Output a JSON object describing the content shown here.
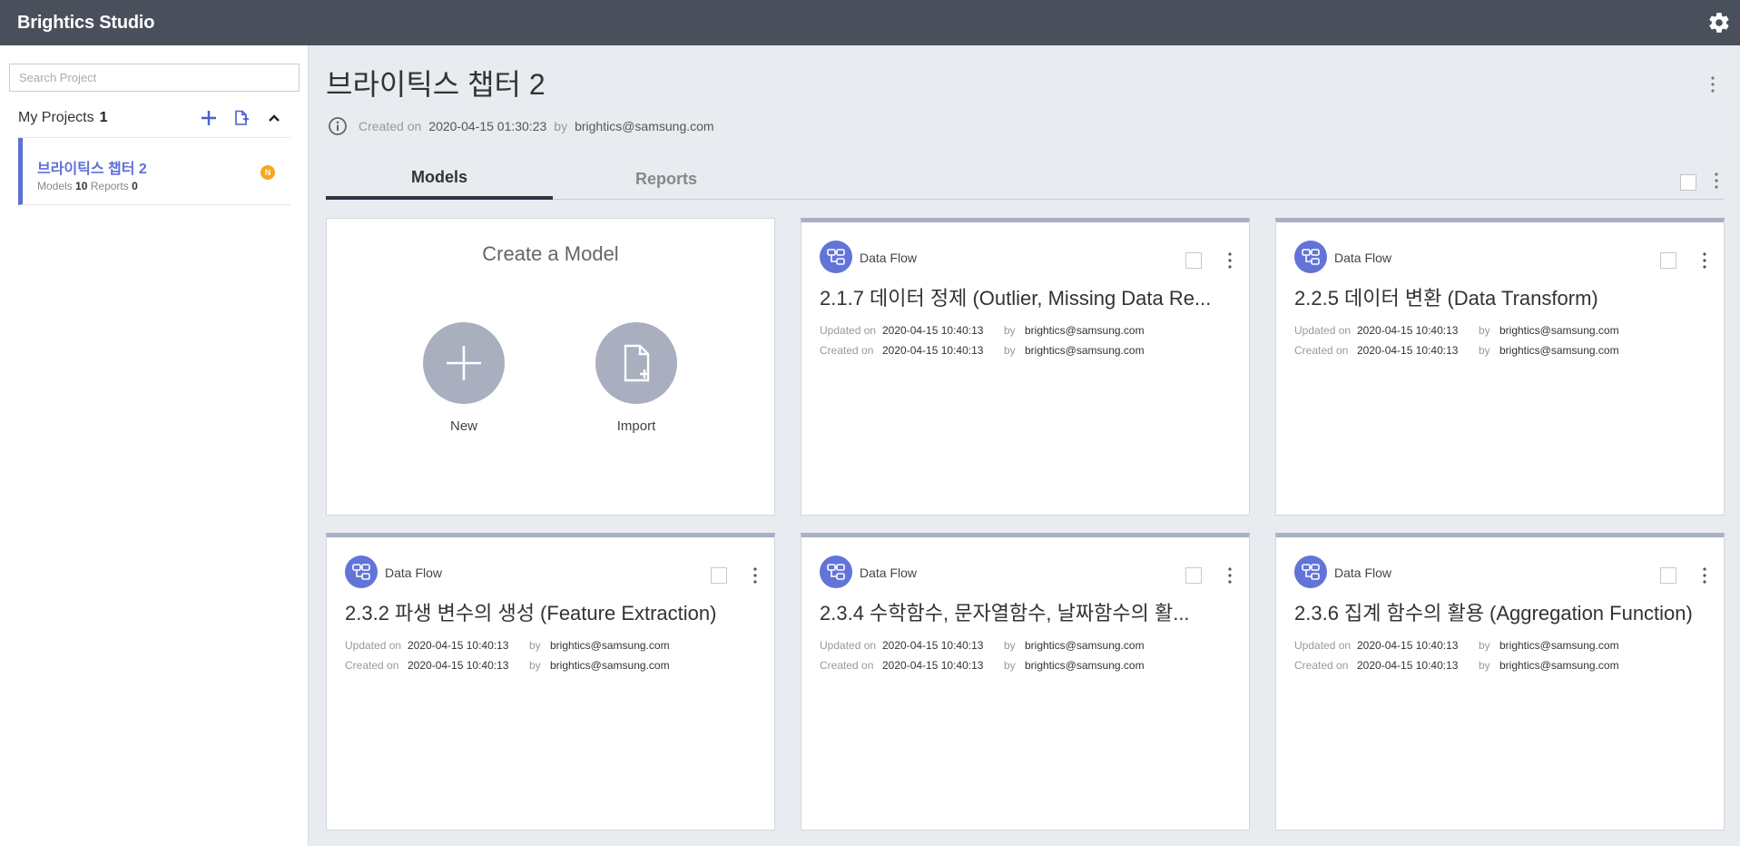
{
  "app": {
    "title": "Brightics Studio"
  },
  "sidebar": {
    "search_placeholder": "Search Project",
    "projects_label": "My Projects",
    "projects_count": "1",
    "projects": [
      {
        "title": "브라이틱스 챕터 2",
        "models_label": "Models",
        "models_count": "10",
        "reports_label": "Reports",
        "reports_count": "0",
        "badge": "N"
      }
    ]
  },
  "main": {
    "project_title": "브라이틱스 챕터 2",
    "created_label": "Created on",
    "created_date": "2020-04-15 01:30:23",
    "by_label": "by",
    "creator": "brightics@samsung.com",
    "tabs": [
      {
        "label": "Models"
      },
      {
        "label": "Reports"
      }
    ],
    "create_card": {
      "title": "Create a Model",
      "new_label": "New",
      "import_label": "Import"
    },
    "models": [
      {
        "type": "Data Flow",
        "title": "2.1.7 데이터 정제 (Outlier, Missing Data Re...",
        "updated_label": "Updated on",
        "updated": "2020-04-15 10:40:13",
        "created_label": "Created on",
        "created": "2020-04-15 10:40:13",
        "by_label": "by",
        "user": "brightics@samsung.com"
      },
      {
        "type": "Data Flow",
        "title": "2.2.5 데이터 변환 (Data Transform)",
        "updated_label": "Updated on",
        "updated": "2020-04-15 10:40:13",
        "created_label": "Created on",
        "created": "2020-04-15 10:40:13",
        "by_label": "by",
        "user": "brightics@samsung.com"
      },
      {
        "type": "Data Flow",
        "title": "2.3.2 파생 변수의 생성 (Feature Extraction)",
        "updated_label": "Updated on",
        "updated": "2020-04-15 10:40:13",
        "created_label": "Created on",
        "created": "2020-04-15 10:40:13",
        "by_label": "by",
        "user": "brightics@samsung.com"
      },
      {
        "type": "Data Flow",
        "title": "2.3.4 수학함수, 문자열함수, 날짜함수의 활...",
        "updated_label": "Updated on",
        "updated": "2020-04-15 10:40:13",
        "created_label": "Created on",
        "created": "2020-04-15 10:40:13",
        "by_label": "by",
        "user": "brightics@samsung.com"
      },
      {
        "type": "Data Flow",
        "title": "2.3.6 집계 함수의 활용 (Aggregation Function)",
        "updated_label": "Updated on",
        "updated": "2020-04-15 10:40:13",
        "created_label": "Created on",
        "created": "2020-04-15 10:40:13",
        "by_label": "by",
        "user": "brightics@samsung.com"
      }
    ]
  },
  "colors": {
    "header": "#4a4f5c",
    "accent": "#5f6fd6",
    "card_icon": "#6274d8",
    "badge": "#f5a623"
  },
  "icons": [
    "gear-icon",
    "plus-icon",
    "import-file-icon",
    "chevron-up-icon",
    "info-icon",
    "more-vertical-icon",
    "data-flow-icon",
    "file-plus-icon"
  ]
}
